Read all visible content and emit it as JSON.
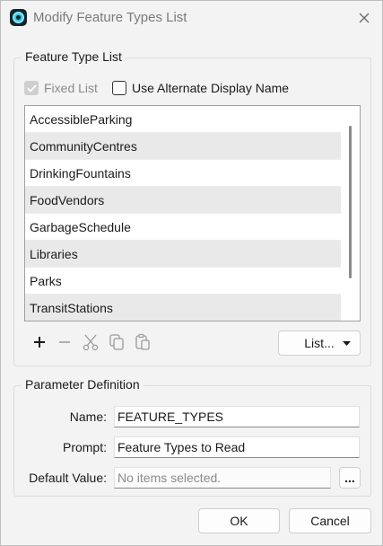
{
  "window": {
    "title": "Modify Feature Types List"
  },
  "feature_type_list": {
    "group_title": "Feature Type List",
    "fixed_list_label": "Fixed List",
    "fixed_list_checked": true,
    "alternate_name_label": "Use Alternate Display Name",
    "alternate_name_checked": false,
    "items": [
      "AccessibleParking",
      "CommunityCentres",
      "DrinkingFountains",
      "FoodVendors",
      "GarbageSchedule",
      "Libraries",
      "Parks",
      "TransitStations"
    ],
    "toolbar_icons": [
      "add-icon",
      "remove-icon",
      "cut-icon",
      "copy-icon",
      "paste-icon"
    ],
    "list_button_label": "List..."
  },
  "parameter_definition": {
    "group_title": "Parameter Definition",
    "name_label": "Name:",
    "name_value": "FEATURE_TYPES",
    "prompt_label": "Prompt:",
    "prompt_value": "Feature Types to Read",
    "default_label": "Default Value:",
    "default_placeholder": "No items selected.",
    "browse_label": "..."
  },
  "footer": {
    "ok_label": "OK",
    "cancel_label": "Cancel"
  }
}
